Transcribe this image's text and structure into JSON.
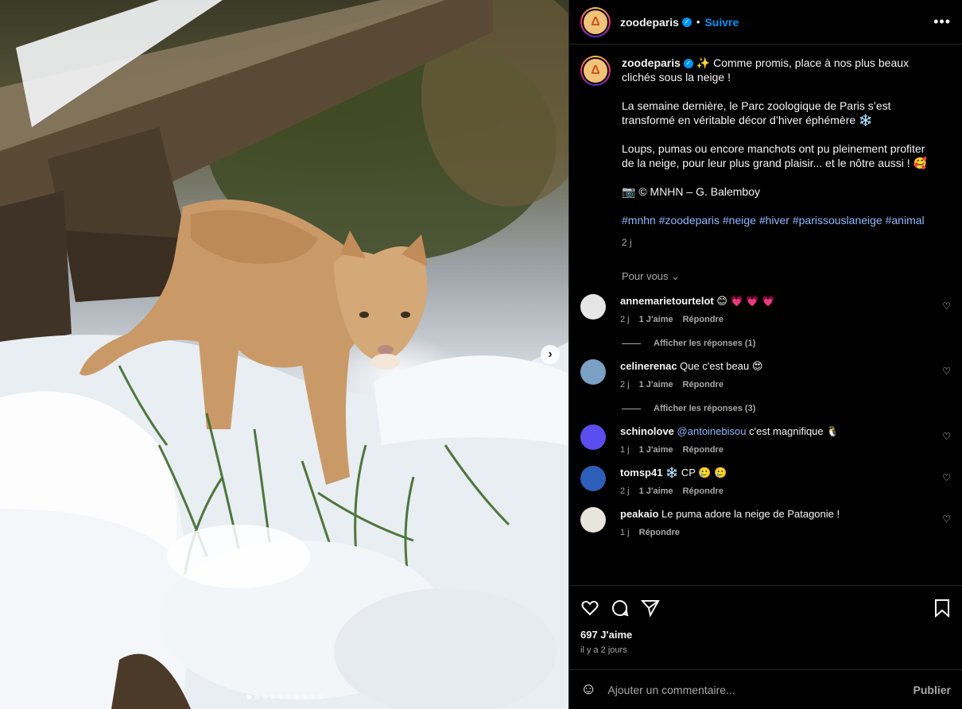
{
  "header": {
    "username": "zoodeparis",
    "follow_label": "Suivre",
    "more_label": "•••"
  },
  "caption": {
    "username": "zoodeparis",
    "line1": "✨ Comme promis, place à nos plus beaux clichés sous la neige !",
    "line2": "La semaine dernière, le Parc zoologique de Paris s’est transformé en véritable décor d’hiver éphémère ❄️",
    "line3": "Loups, pumas ou encore manchots ont pu pleinement profiter de la neige, pour leur plus grand plaisir... et le nôtre aussi ! 🥰",
    "line4": "📷 © MNHN – G. Balemboy",
    "hashtags": [
      "#mnhn",
      "#zoodeparis",
      "#neige",
      "#hiver",
      "#parissouslaneige",
      "#animal"
    ],
    "time": "2 j"
  },
  "pour_vous": "Pour vous",
  "comments": [
    {
      "user": "annemarietourtelot",
      "text": "😊 💗 💗 💗",
      "mention": "",
      "time": "2 j",
      "likes": "1 J'aime",
      "reply": "Répondre",
      "replies": "Afficher les réponses (1)",
      "avatar_color": "#e6e6e6"
    },
    {
      "user": "celinerenac",
      "text": "Que c'est beau 😍",
      "mention": "",
      "time": "2 j",
      "likes": "1 J'aime",
      "reply": "Répondre",
      "replies": "Afficher les réponses (3)",
      "avatar_color": "#7aa0c4"
    },
    {
      "user": "schinolove",
      "text": "c'est magnifique 🐧",
      "mention": "@antoinebisou",
      "time": "1 j",
      "likes": "1 J'aime",
      "reply": "Répondre",
      "replies": "",
      "avatar_color": "#5b4df0"
    },
    {
      "user": "tomsp41",
      "text": "❄️ CP 🥲 🥲",
      "mention": "",
      "time": "2 j",
      "likes": "1 J'aime",
      "reply": "Répondre",
      "replies": "",
      "avatar_color": "#2e5fb8"
    },
    {
      "user": "peakaio",
      "text": "Le puma adore la neige de Patagonie !",
      "mention": "",
      "time": "1 j",
      "likes": "",
      "reply": "Répondre",
      "replies": "",
      "avatar_color": "#e9e4dc"
    }
  ],
  "actions": {
    "likes_count": "697 J'aime",
    "posted_ago": "il y a 2 jours"
  },
  "add_comment": {
    "placeholder": "Ajouter un commentaire...",
    "publish_label": "Publier"
  },
  "carousel": {
    "total_slides": 10,
    "active_index": 0
  }
}
